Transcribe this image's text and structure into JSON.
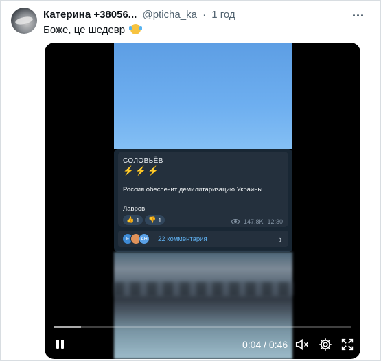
{
  "tweet": {
    "author_name": "Катерина +38056...",
    "handle": "@pticha_ka",
    "separator": "·",
    "time": "1 год",
    "text": "Боже, це шедевр",
    "emoji": "face-with-tears-of-joy"
  },
  "telegram_post": {
    "channel": "СОЛОВЬЁВ",
    "bolts": "⚡⚡⚡",
    "message": "Россия обеспечит демилитаризацию Украины",
    "signature": "Лавров",
    "reactions": [
      {
        "emoji": "👍",
        "count": "1"
      },
      {
        "emoji": "👎",
        "count": "1"
      }
    ],
    "views": "147.8K",
    "time": "12:30",
    "comment_avatars": [
      "F",
      "",
      "АН"
    ],
    "comments": "22 комментария",
    "chevron": "›"
  },
  "player": {
    "current_time": "0:04",
    "duration": "0:46",
    "timecode": "0:04 / 0:46",
    "progress": 0.09
  },
  "colors": {
    "video_bg": "#000000",
    "post_bg": "#24303d",
    "link_blue": "#5fb0f0"
  }
}
